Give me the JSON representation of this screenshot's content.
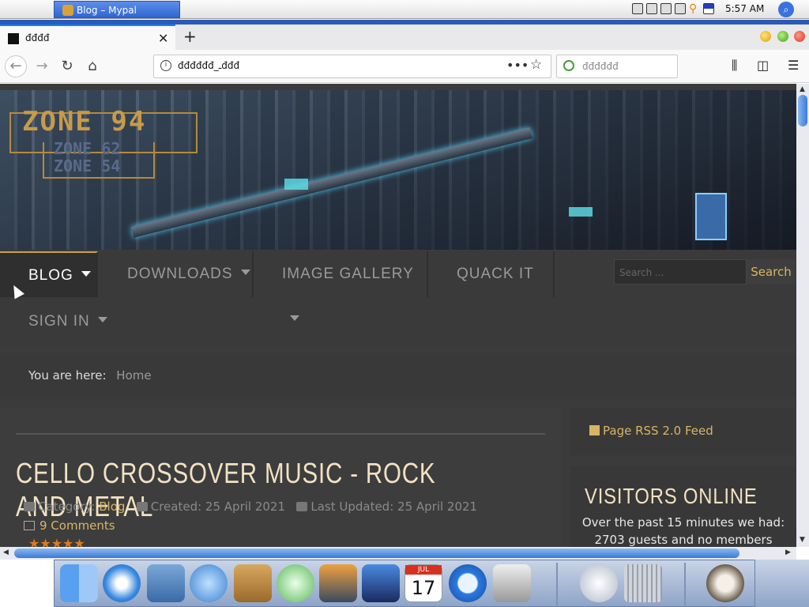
{
  "menubar": {
    "task_title": "Blog – Mypal",
    "clock": "5:57 AM"
  },
  "browser": {
    "tab_title": "đđđđ",
    "url": "đđđđđđ_ـđđđ",
    "search_placeholder": "đđđđđđ"
  },
  "site": {
    "banner": {
      "logo_main": "ZONE 94",
      "logo_sub1": "ZONE 62",
      "logo_sub2": "ZONE 54"
    },
    "menu": {
      "items": [
        {
          "label": "BLOG",
          "dropdown": true
        },
        {
          "label": "DOWNLOADS",
          "dropdown": true
        },
        {
          "label": "IMAGE GALLERY",
          "dropdown": true
        },
        {
          "label": "QUACK IT",
          "dropdown": false
        },
        {
          "label": "SIGN IN",
          "dropdown": true
        }
      ],
      "search_placeholder": "Search ...",
      "search_button": "Search"
    },
    "breadcrumb": {
      "prefix": "You are here:",
      "home": "Home"
    },
    "article": {
      "title": "CELLO CROSSOVER MUSIC - ROCK AND METAL",
      "category_label": "Category:",
      "category": "Blog",
      "created": "Created: 25 April 2021",
      "updated": "Last Updated: 25 April 2021",
      "comments": "9 Comments",
      "stars": "★★★★★"
    },
    "sidebar": {
      "rss": "Page RSS 2.0 Feed",
      "visitors_title": "VISITORS ONLINE",
      "visitors_line1": "Over the past 15 minutes we had:",
      "visitors_line2": "2703 guests and no members"
    }
  },
  "colors": {
    "accent": "#d8b566",
    "heading": "#f1e2c2",
    "page_bg": "#3b3b3b"
  },
  "dock": {
    "icons": [
      "finder-icon",
      "safari-icon",
      "mail-icon",
      "ichat-icon",
      "address-book-icon",
      "itunes-icon",
      "iphoto-icon",
      "imovie-icon",
      "ical-icon",
      "quicktime-icon",
      "system-preferences-icon",
      "mail-at-icon",
      "trash-icon",
      "mypal-raccoon-icon"
    ],
    "ical_day": "17",
    "ical_month": "JUL"
  }
}
